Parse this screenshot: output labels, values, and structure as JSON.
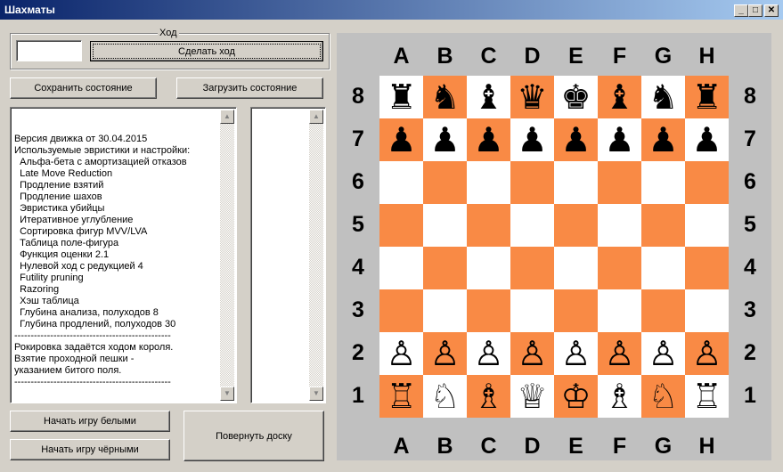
{
  "window": {
    "title": "Шахматы",
    "minimize": "_",
    "maximize": "□",
    "close": "✕"
  },
  "move": {
    "group_label": "Ход",
    "input_value": "",
    "make_move": "Сделать ход"
  },
  "save_state": "Сохранить состояние",
  "load_state": "Загрузить состояние",
  "info_lines": [
    "Версия движка от 30.04.2015",
    "Используемые эвристики и настройки:",
    "  Альфа-бета с амортизацией отказов",
    "  Late Move Reduction",
    "  Продление взятий",
    "  Продление шахов",
    "  Эвристика убийцы",
    "  Итеративное углубление",
    "  Сортировка фигур MVV/LVA",
    "  Таблица поле-фигура",
    "  Функция оценки 2.1",
    "  Нулевой ход с редукцией 4",
    "  Futility pruning",
    "  Razoring",
    "  Хэш таблица",
    "  Глубина анализа, полуходов 8",
    "  Глубина продлений, полуходов 30",
    "------------------------------------------------",
    "Рокировка задаётся ходом короля.",
    "Взятие проходной пешки -",
    "указанием битого поля.",
    "------------------------------------------------"
  ],
  "moves_list": [],
  "start_white": "Начать игру белыми",
  "start_black": "Начать игру чёрными",
  "flip_board": "Повернуть доску",
  "board": {
    "files": [
      "A",
      "B",
      "C",
      "D",
      "E",
      "F",
      "G",
      "H"
    ],
    "ranks": [
      "8",
      "7",
      "6",
      "5",
      "4",
      "3",
      "2",
      "1"
    ],
    "position": [
      "rnbqkbnr",
      "pppppppp",
      "........",
      "........",
      "........",
      "........",
      "PPPPPPPP",
      "RNBQKBNR"
    ],
    "colors": {
      "light": "#ffffff",
      "dark": "#f98a45",
      "frame": "#c0c0c0"
    }
  }
}
